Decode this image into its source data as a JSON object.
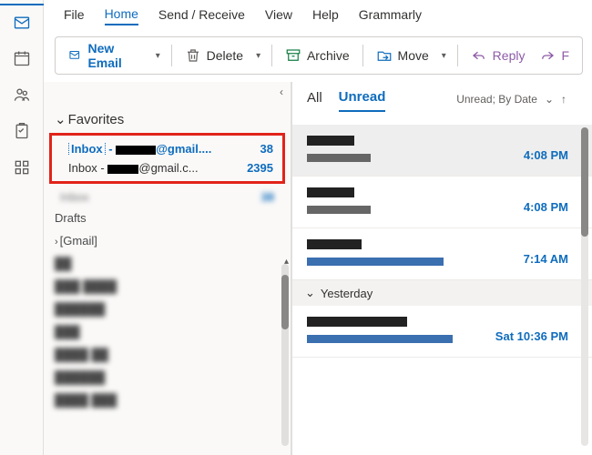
{
  "menubar": {
    "file": "File",
    "home": "Home",
    "sendreceive": "Send / Receive",
    "view": "View",
    "help": "Help",
    "grammarly": "Grammarly"
  },
  "ribbon": {
    "newEmail": "New Email",
    "delete": "Delete",
    "archive": "Archive",
    "move": "Move",
    "reply": "Reply",
    "forward": "F"
  },
  "tree": {
    "favorites": "Favorites",
    "inbox1": {
      "label": "Inbox",
      "account": "@gmail....",
      "count": "38"
    },
    "inbox2": {
      "label": "Inbox -",
      "account": "@gmail.c...",
      "count": "2395"
    },
    "inboxDup": {
      "label": "Inbox",
      "count": "38"
    },
    "drafts": "Drafts",
    "gmail": "[Gmail]"
  },
  "list": {
    "tabAll": "All",
    "tabUnread": "Unread",
    "filter": "Unread; By Date",
    "msg1": {
      "time": "4:08 PM"
    },
    "msg2": {
      "time": "4:08 PM"
    },
    "msg3": {
      "time": "7:14 AM"
    },
    "groupYesterday": "Yesterday",
    "msg4": {
      "time": "Sat 10:36 PM"
    }
  }
}
